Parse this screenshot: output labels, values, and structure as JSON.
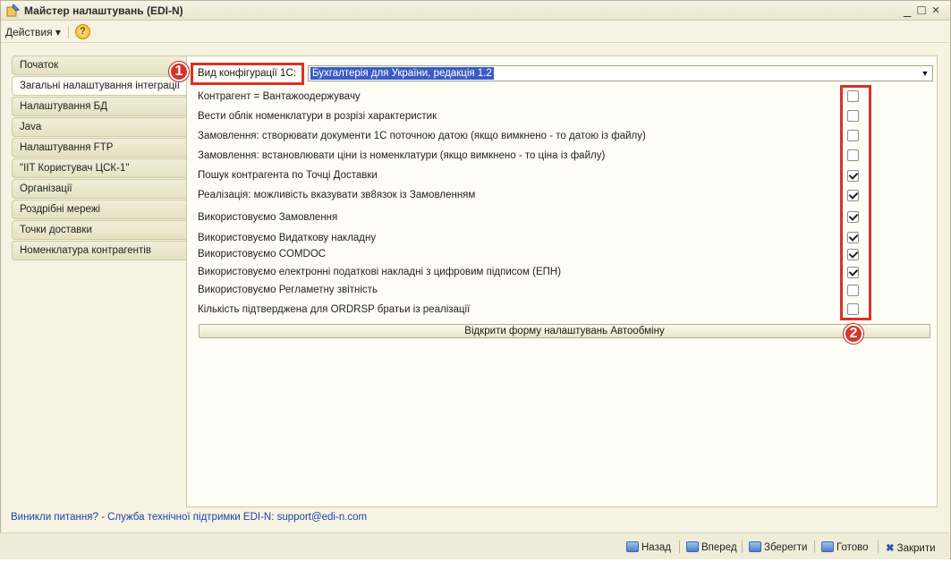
{
  "window": {
    "title": "Майстер налаштувань (EDI-N)",
    "controls": [
      "_",
      "□",
      "×"
    ]
  },
  "menu": {
    "actions_label": "Действия ▾",
    "help_icon": "?"
  },
  "tabs": [
    {
      "label": "Початок"
    },
    {
      "label": "Загальні налаштування інтеграції"
    },
    {
      "label": "Налаштування БД"
    },
    {
      "label": "Java"
    },
    {
      "label": "Налаштування FTP"
    },
    {
      "label": "\"IIT Користувач ЦСК-1\""
    },
    {
      "label": "Організації"
    },
    {
      "label": "Роздрібні мережі"
    },
    {
      "label": "Точки доставки"
    },
    {
      "label": "Номенклатура контрагентів"
    }
  ],
  "config": {
    "label": "Вид конфігурації 1С:",
    "value": "Бухгалтерія для України, редакція 1.2"
  },
  "options": [
    {
      "label": "Контрагент = Вантажоодержувачу",
      "checked": false
    },
    {
      "label": "Вести облік номенклатури в розрізі характеристик",
      "checked": false
    },
    {
      "label": "Замовлення: створювати документи 1С поточною датою (якщо вимкнено - то датою із файлу)",
      "checked": false
    },
    {
      "label": "Замовлення: встановлювати ціни із номенклатури (якщо вимкнено - то ціна із файлу)",
      "checked": false
    },
    {
      "label": "Пошук контрагента по Точці Доставки",
      "checked": true
    },
    {
      "label": "Реалізація: можливість вказувати зв8язок із Замовленням",
      "checked": true
    },
    {
      "label": "Використовуємо Замовлення",
      "checked": true
    },
    {
      "label": "Використовуємо Видаткову накладну",
      "checked": true
    },
    {
      "label": "Використовуємо COMDOC",
      "checked": true
    },
    {
      "label": "Використовуємо електронні податкові накладні з цифровим підписом (ЕПН)",
      "checked": true
    },
    {
      "label": "Використовуємо Регламетну звітність",
      "checked": false
    },
    {
      "label": "Кількість підтверджена для ORDRSP братьи із реалізації",
      "checked": false
    }
  ],
  "open_button": "Відкрити форму налаштувань Автообміну",
  "markers": {
    "one": "1",
    "two": "2"
  },
  "support_text": "Виникли питання? - Служба технічної підтримки EDI-N: support@edi-n.com",
  "bottom": {
    "back": "Назад",
    "forward": "Вперед",
    "save": "Зберегти",
    "done": "Готово",
    "close": "Закрити"
  },
  "colors": {
    "highlight": "#d9312b",
    "selection": "#3b5cc4",
    "link": "#1f3fa8"
  }
}
